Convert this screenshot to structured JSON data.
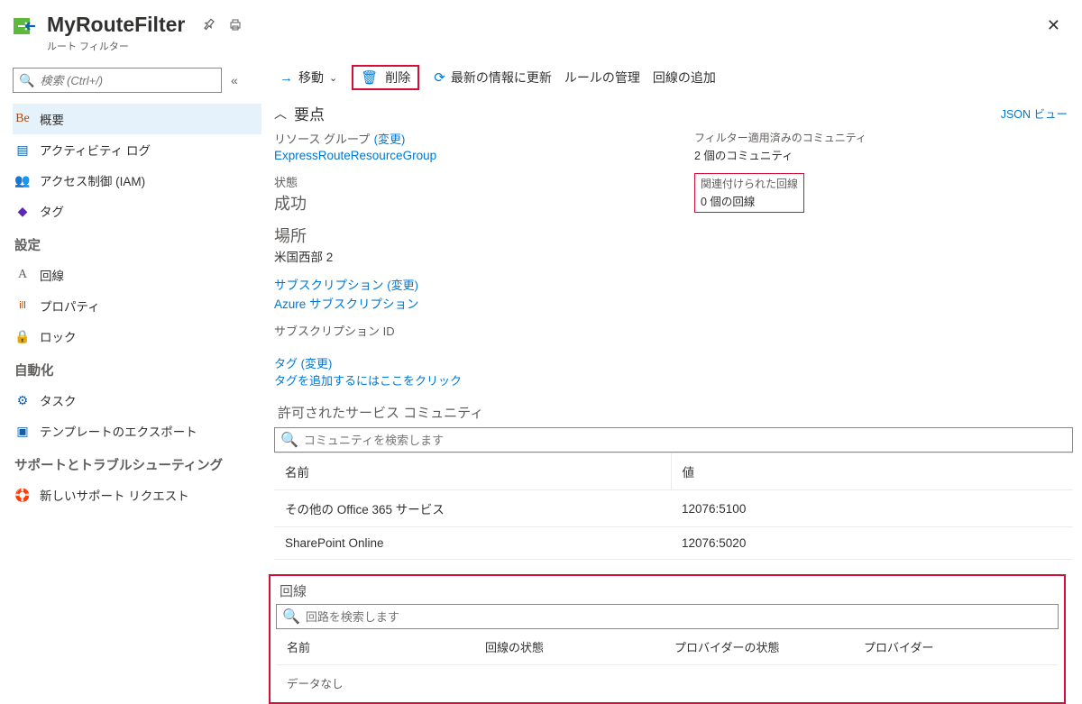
{
  "header": {
    "title": "MyRouteFilter",
    "subtitle": "ルート フィルター"
  },
  "sidebar": {
    "search_placeholder": "検索 (Ctrl+/)",
    "items": {
      "overview": "概要",
      "activity": "アクティビティ ログ",
      "iam": "アクセス制御 (IAM)",
      "tags": "タグ"
    },
    "group_settings": "設定",
    "settings": {
      "circuits": "回線",
      "properties": "プロパティ",
      "locks": "ロック"
    },
    "group_automation": "自動化",
    "automation": {
      "tasks": "タスク",
      "export_template": "テンプレートのエクスポート"
    },
    "group_support": "サポートとトラブルシューティング",
    "support": {
      "new_request": "新しいサポート リクエスト"
    }
  },
  "toolbar": {
    "move": "移動",
    "delete": "削除",
    "refresh": "最新の情報に更新",
    "manage_rules_extra": "ルールの管理",
    "add_circuit": "回線の追加"
  },
  "essentials": {
    "heading": "要点",
    "json_view": "JSON ビュー",
    "resource_group_label": "リソース グループ",
    "change": "(変更)",
    "resource_group_value": "ExpressRouteResourceGroup",
    "status_label": "状態",
    "status_value": "成功",
    "location_label": "場所",
    "location_value": "米国西部 2",
    "subscription_label": "サブスクリプション",
    "subscription_value": "Azure サブスクリプション",
    "subscription_id_label": "サブスクリプション ID",
    "applied_label": "フィルター適用済みのコミュニティ",
    "applied_value": "2 個のコミュニティ",
    "associated_label": "関連付けられた回線",
    "associated_value": "0 個の回線",
    "tags_label": "タグ",
    "tags_hint": "タグを追加するにはここをクリック"
  },
  "communities": {
    "title": "許可されたサービス コミュニティ",
    "search_placeholder": "コミュニティを検索します",
    "col_name": "名前",
    "col_value": "値",
    "rows": [
      {
        "name": "その他の Office 365 サービス",
        "value": "12076:5100"
      },
      {
        "name": "SharePoint Online",
        "value": "12076:5020"
      }
    ]
  },
  "circuits": {
    "title": "回線",
    "search_placeholder": "回路を検索します",
    "col_name": "名前",
    "col_circuit_state": "回線の状態",
    "col_provider_state": "プロバイダーの状態",
    "col_provider": "プロバイダー",
    "no_data": "データなし"
  }
}
